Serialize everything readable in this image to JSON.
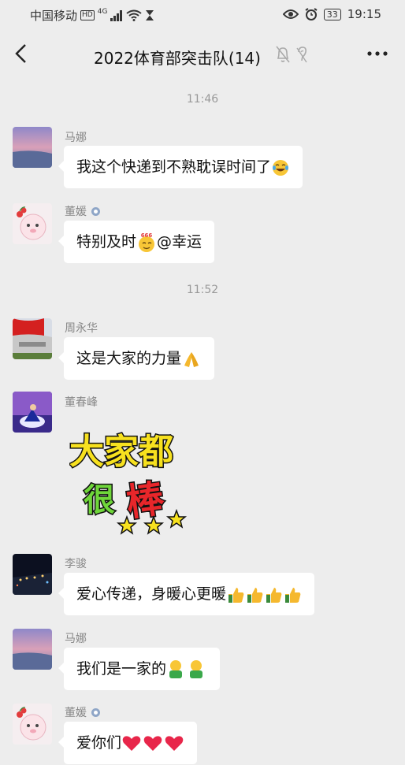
{
  "status_bar": {
    "carrier": "中国移动",
    "hd": "HD",
    "network": "4G",
    "battery": "33",
    "time": "19:15"
  },
  "header": {
    "title": "2022体育部突击队(14)"
  },
  "timestamps": [
    "11:46",
    "11:52"
  ],
  "messages": [
    {
      "sender": "马娜",
      "text": "我这个快递到不熟耽误时间了",
      "emoji": "laughing-crying-emoji"
    },
    {
      "sender": "董媛",
      "text_before": "特别及时",
      "text_after": "@幸运",
      "emoji": "666-emoji"
    },
    {
      "sender": "周永华",
      "text": "这是大家的力量",
      "emoji": "praying-hands-emoji"
    },
    {
      "sender": "董春峰",
      "sticker": {
        "line1": "大家都",
        "line2a": "很",
        "line2b": "棒"
      }
    },
    {
      "sender": "李骏",
      "text": "爱心传递，身暖心更暖",
      "emoji": "thumbs-up-emoji"
    },
    {
      "sender": "马娜",
      "text": "我们是一家的",
      "emoji": "hug-emoji"
    },
    {
      "sender": "董媛",
      "text": "爱你们",
      "emoji": "red-heart-emoji"
    }
  ],
  "colors": {
    "background": "#ededed",
    "bubble": "#ffffff",
    "sticker_yellow": "#f7e11f",
    "sticker_green": "#6fd63a",
    "sticker_red": "#e8262a"
  }
}
